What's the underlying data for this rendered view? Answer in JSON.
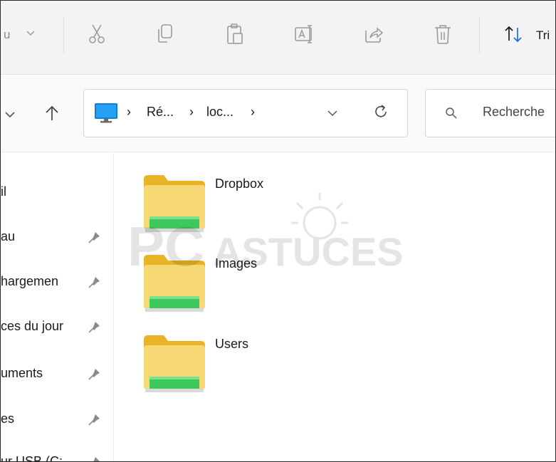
{
  "toolbar": {
    "truncated_left": "u",
    "sort_label": "Tri",
    "icons": [
      "chevron-down-icon",
      "cut-icon",
      "copy-icon",
      "paste-icon",
      "rename-icon",
      "share-icon",
      "delete-icon",
      "sort-icon"
    ]
  },
  "address_bar": {
    "crumbs": [
      "Ré...",
      "loc..."
    ],
    "search_placeholder": "Recherche"
  },
  "sidebar": {
    "items": [
      {
        "label": "il",
        "pinned": false
      },
      {
        "label": "au",
        "pinned": true
      },
      {
        "label": "hargemen",
        "pinned": true
      },
      {
        "label": "ces du jour",
        "pinned": true
      },
      {
        "label": "uments",
        "pinned": true
      },
      {
        "label": "es",
        "pinned": true
      },
      {
        "label": "ur USB (C:",
        "pinned": true
      }
    ]
  },
  "folders": [
    {
      "name": "Dropbox"
    },
    {
      "name": "Images"
    },
    {
      "name": "Users"
    }
  ],
  "watermark": {
    "left": "PC",
    "right": "ASTUCES"
  },
  "colors": {
    "folder_body": "#f8d775",
    "folder_tab": "#e8b326",
    "folder_share": "#3cc85a",
    "pc_icon": "#0f7fd6"
  }
}
